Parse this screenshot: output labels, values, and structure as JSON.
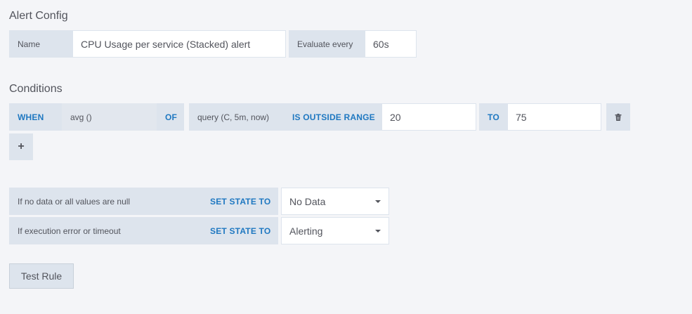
{
  "alert_config": {
    "title": "Alert Config",
    "name_label": "Name",
    "name_value": "CPU Usage per service (Stacked) alert",
    "evaluate_label": "Evaluate every",
    "evaluate_value": "60s"
  },
  "conditions": {
    "title": "Conditions",
    "when_label": "WHEN",
    "reducer": "avg ()",
    "of_label": "OF",
    "query": "query (C, 5m, now)",
    "evaluator": "IS OUTSIDE RANGE",
    "from_value": "20",
    "to_label": "TO",
    "to_value": "75",
    "delete_icon": "trash-icon",
    "add_icon": "plus-icon",
    "add_label": "+"
  },
  "no_data": {
    "label": "If no data or all values are null",
    "set_state_label": "SET STATE TO",
    "selected": "No Data"
  },
  "exec_error": {
    "label": "If execution error or timeout",
    "set_state_label": "SET STATE TO",
    "selected": "Alerting"
  },
  "actions": {
    "test_rule_label": "Test Rule"
  },
  "colors": {
    "background": "#f4f5f8",
    "label_bg": "#dde4ed",
    "keyword": "#1f78c1",
    "text": "#52545c"
  }
}
